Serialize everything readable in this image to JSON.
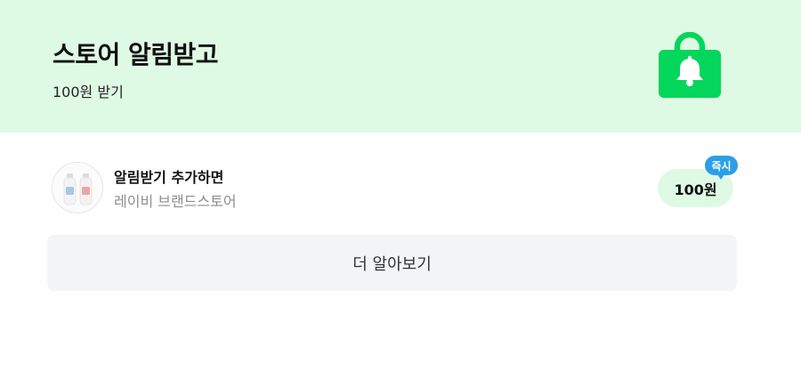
{
  "banner": {
    "title": "스토어 알림받고",
    "subtitle": "100원 받기",
    "background_color": "#dffae4",
    "icon": "shopping-bag-bell-icon",
    "icon_color": "#03d65a"
  },
  "store_offer": {
    "title": "알림받기 추가하면",
    "store_name": "레이비 브랜드스토어",
    "thumbnail": "product-bottles-thumbnail",
    "reward": "100원",
    "badge": "즉시",
    "badge_color": "#2c9ee8"
  },
  "more_button": {
    "label": "더 알아보기"
  }
}
